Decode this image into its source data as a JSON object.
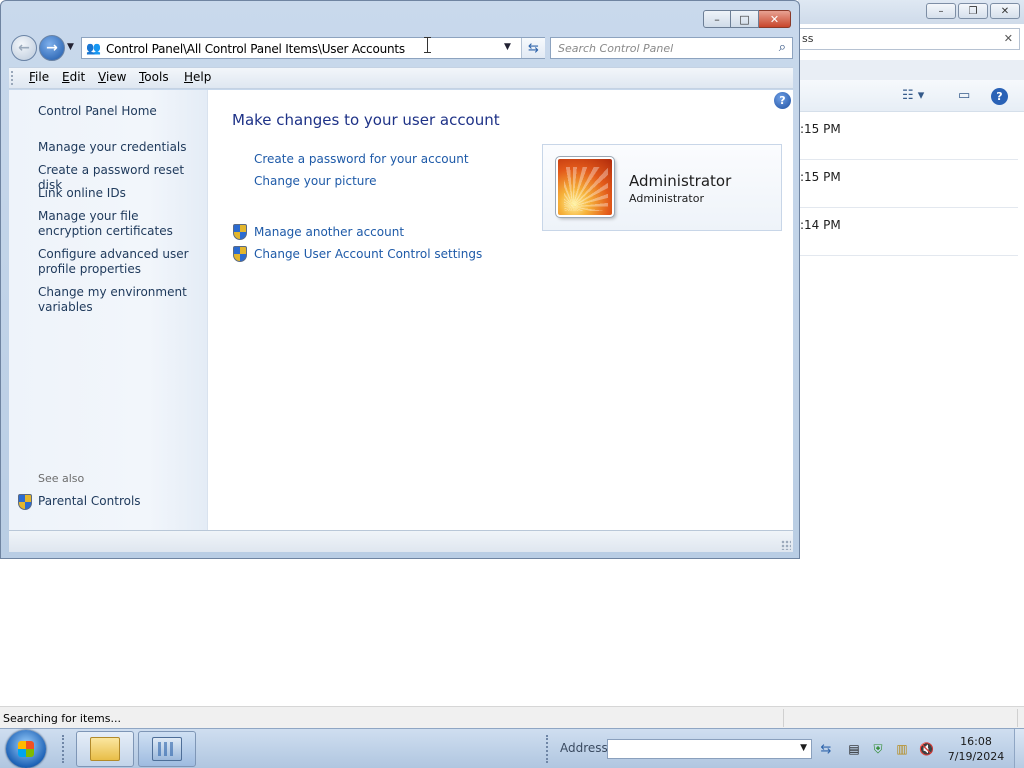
{
  "window": {
    "address_path": "Control Panel\\All Control Panel Items\\User Accounts",
    "search_placeholder": "Search Control Panel",
    "caption": {
      "minimize": "–",
      "maximize": "□",
      "close": "✕"
    }
  },
  "menu": [
    "File",
    "Edit",
    "View",
    "Tools",
    "Help"
  ],
  "left_pane": {
    "home": "Control Panel Home",
    "links": [
      "Manage your credentials",
      "Create a password reset disk",
      "Link online IDs",
      "Manage your file encryption certificates",
      "Configure advanced user profile properties",
      "Change my environment variables"
    ],
    "see_also_label": "See also",
    "see_also_links": [
      "Parental Controls"
    ]
  },
  "main": {
    "title": "Make changes to your user account",
    "tasks": [
      "Create a password for your account",
      "Change your picture"
    ],
    "shield_tasks": [
      "Manage another account",
      "Change User Account Control settings"
    ],
    "account": {
      "name": "Administrator",
      "type": "Administrator"
    }
  },
  "background_window": {
    "search_fragment": "ss",
    "times": [
      ":15 PM",
      ":15 PM",
      ":14 PM"
    ]
  },
  "explorer_status": "Searching for items...",
  "taskbar": {
    "address_label": "Address",
    "time": "16:08",
    "date": "7/19/2024"
  }
}
